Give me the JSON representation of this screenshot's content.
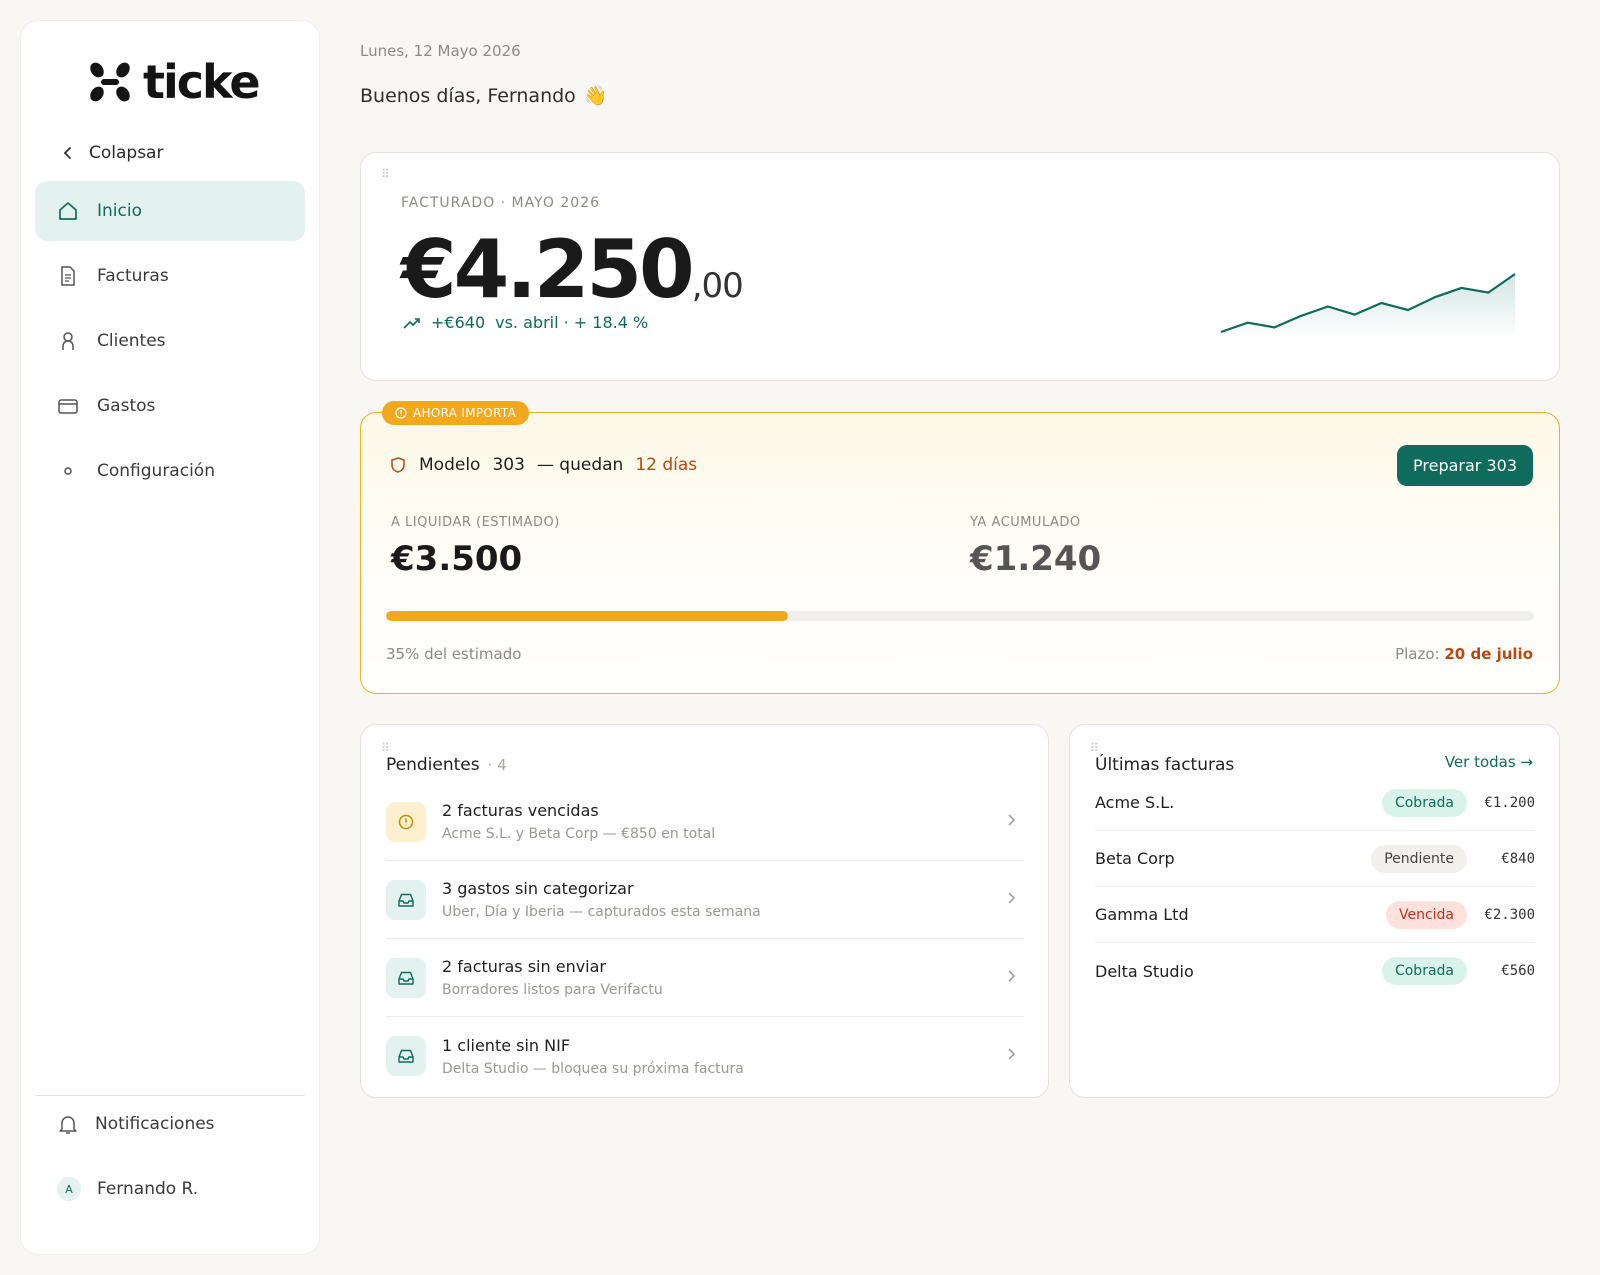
{
  "brand": {
    "name": "ticke",
    "accent": "#0f6b5c",
    "warning": "#f2a81d"
  },
  "sidebar": {
    "collapse_label": "Colapsar",
    "items": [
      {
        "label": "Inicio",
        "icon": "home-icon",
        "active": true
      },
      {
        "label": "Facturas",
        "icon": "document-icon"
      },
      {
        "label": "Clientes",
        "icon": "user-icon"
      },
      {
        "label": "Gastos",
        "icon": "card-icon"
      },
      {
        "label": "Configuración",
        "icon": "dot-icon"
      }
    ],
    "notifications_label": "Notificaciones",
    "user": {
      "initial": "A",
      "name": "Fernando R."
    }
  },
  "header": {
    "date": "Lunes, 12 Mayo 2026",
    "greeting": "Buenos días, Fernando",
    "greeting_emoji": "👋"
  },
  "revenue": {
    "label": "FACTURADO · MAYO 2026",
    "amount": "€4.250",
    "cents": ",00",
    "delta": "+€640",
    "delta_text": "vs. abril · + 18.4 %",
    "sparkline": [
      12,
      20,
      16,
      26,
      34,
      27,
      37,
      31,
      42,
      50,
      46,
      62
    ]
  },
  "tax": {
    "pill": "AHORA IMPORTA",
    "title_model": "Modelo",
    "title_number": "303",
    "title_mid": "— quedan",
    "title_days": "12 días",
    "button": "Preparar 303",
    "to_pay_label": "A LIQUIDAR (ESTIMADO)",
    "to_pay_value": "€3.500",
    "accumulated_label": "YA ACUMULADO",
    "accumulated_value": "€1.240",
    "progress": 0.35,
    "progress_text": "35% del estimado",
    "deadline_label": "Plazo:",
    "deadline": "20 de julio"
  },
  "pending": {
    "title": "Pendientes",
    "count": "· 4",
    "items": [
      {
        "title": "2 facturas vencidas",
        "sub": "Acme S.L. y Beta Corp — €850 en total",
        "icon": "alert-icon",
        "tone": "warn"
      },
      {
        "title": "3 gastos sin categorizar",
        "sub": "Uber, Día y Iberia — capturados esta semana",
        "icon": "inbox-icon",
        "tone": "mint"
      },
      {
        "title": "2 facturas sin enviar",
        "sub": "Borradores listos para Verifactu",
        "icon": "inbox-icon",
        "tone": "mint"
      },
      {
        "title": "1 cliente sin NIF",
        "sub": "Delta Studio — bloquea su próxima factura",
        "icon": "inbox-icon",
        "tone": "mint"
      }
    ]
  },
  "invoices": {
    "title": "Últimas facturas",
    "see_all": "Ver todas →",
    "rows": [
      {
        "client": "Acme S.L.",
        "status": "Cobrada",
        "status_type": "paid",
        "amount": "€1.200"
      },
      {
        "client": "Beta Corp",
        "status": "Pendiente",
        "status_type": "pending",
        "amount": "€840"
      },
      {
        "client": "Gamma Ltd",
        "status": "Vencida",
        "status_type": "overdue",
        "amount": "€2.300"
      },
      {
        "client": "Delta Studio",
        "status": "Cobrada",
        "status_type": "paid",
        "amount": "€560"
      }
    ]
  }
}
